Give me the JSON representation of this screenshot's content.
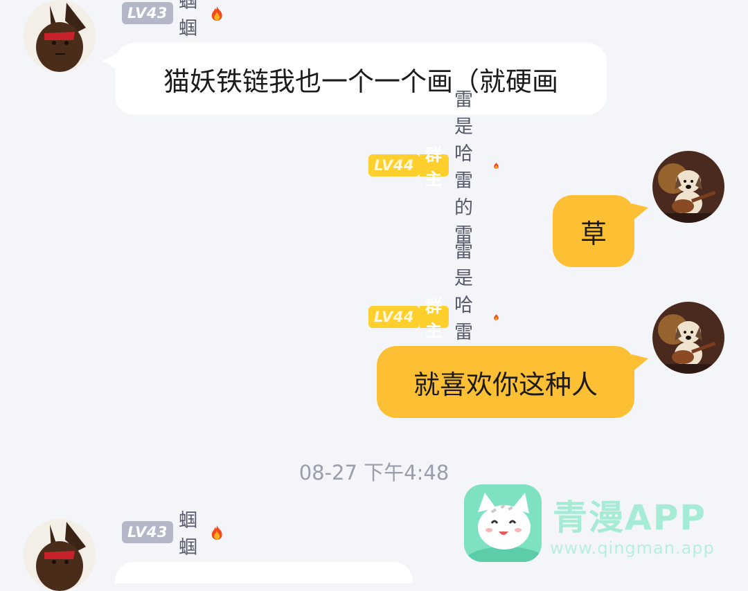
{
  "messages": [
    {
      "side": "left",
      "level": "LV43",
      "nickname": "蝈蝈",
      "text": "猫妖铁链我也一个一个画（就硬画",
      "bubble_color": "#ffffff"
    },
    {
      "side": "right",
      "level": "LV44",
      "role": "群主",
      "nickname": "雷是哈雷的雷",
      "text": "草",
      "bubble_color": "#fdbf34"
    },
    {
      "side": "right",
      "level": "LV44",
      "role": "群主",
      "nickname": "雷是哈雷的雷",
      "text": "就喜欢你这种人",
      "bubble_color": "#fdbf34"
    },
    {
      "side": "left",
      "level": "LV43",
      "nickname": "蝈蝈",
      "text": "",
      "bubble_color": "#ffffff"
    }
  ],
  "timestamp": "08-27 下午4:48",
  "watermark": {
    "title": "青漫APP",
    "url": "www.qingman.app"
  },
  "colors": {
    "background": "#f4f5f9",
    "owner_badge": "#ffcf2e",
    "member_badge": "#b3b7c7",
    "self_bubble": "#fdbf34",
    "other_bubble": "#ffffff"
  },
  "icons": {
    "flame": "flame-icon",
    "avatar_left": "rabbit-avatar",
    "avatar_right": "dog-guitar-avatar"
  }
}
